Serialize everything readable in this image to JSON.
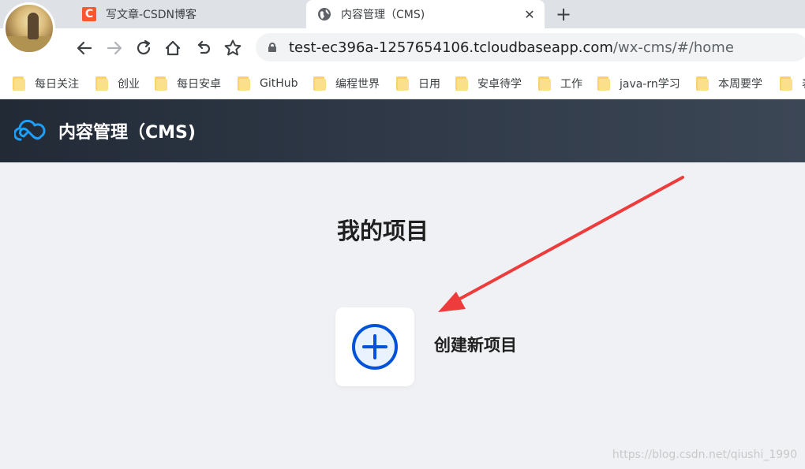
{
  "browser": {
    "tabs": [
      {
        "title": "写文章-CSDN博客",
        "favicon": "C",
        "active": false
      },
      {
        "title": "内容管理（CMS)",
        "favicon": "globe-icon",
        "active": true
      }
    ],
    "address": {
      "host": "test-ec396a-1257654106.tcloudbaseapp.com",
      "path": "/wx-cms/#/home"
    },
    "bookmarks": [
      "每日关注",
      "创业",
      "每日安卓",
      "GitHub",
      "编程世界",
      "日用",
      "安卓待学",
      "工作",
      "java-rn学习",
      "本周要学",
      "表"
    ]
  },
  "app": {
    "title": "内容管理（CMS)",
    "accent": "#0052d9",
    "logo_color": "#1e9fff"
  },
  "main": {
    "heading": "我的项目",
    "create_project_label": "创建新项目"
  },
  "annotation": {
    "arrow_color": "#ee3c3c"
  },
  "watermark": "https://blog.csdn.net/qiushi_1990"
}
